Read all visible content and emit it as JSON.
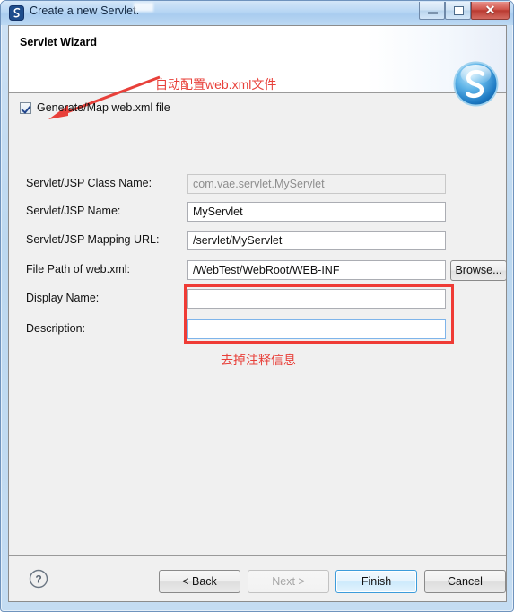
{
  "window": {
    "title": "Create a new Servlet.",
    "icon": "myeclipse-servlet-icon",
    "controls": {
      "minimize": "minimize-button",
      "maximize": "maximize-button",
      "close_glyph": "✕"
    }
  },
  "header": {
    "title": "Servlet Wizard",
    "logo": "blue-sphere-s-logo"
  },
  "annotations": {
    "top_text": "自动配置web.xml文件",
    "bottom_text": "去掉注释信息",
    "color": "#e8403a",
    "box_color": "#ef3b35"
  },
  "form": {
    "checkbox": {
      "label": "Generate/Map web.xml file",
      "checked": true
    },
    "fields": [
      {
        "label": "Servlet/JSP Class Name:",
        "value": "com.vae.servlet.MyServlet",
        "placeholder": "",
        "state": "disabled"
      },
      {
        "label": "Servlet/JSP Name:",
        "value": "MyServlet",
        "placeholder": "",
        "state": "normal"
      },
      {
        "label": "Servlet/JSP Mapping URL:",
        "value": "/servlet/MyServlet",
        "placeholder": "",
        "state": "normal"
      },
      {
        "label": "File Path of web.xml:",
        "value": "/WebTest/WebRoot/WEB-INF",
        "placeholder": "",
        "state": "normal"
      },
      {
        "label": "Display Name:",
        "value": "",
        "placeholder": "",
        "state": "normal"
      },
      {
        "label": "Description:",
        "value": "",
        "placeholder": "",
        "state": "focused"
      }
    ],
    "browse_label": "Browse..."
  },
  "footer": {
    "help": "help-icon",
    "buttons": [
      {
        "label": "< Back",
        "state": "normal"
      },
      {
        "label": "Next >",
        "state": "disabled"
      },
      {
        "label": "Finish",
        "state": "default"
      },
      {
        "label": "Cancel",
        "state": "normal"
      }
    ]
  }
}
